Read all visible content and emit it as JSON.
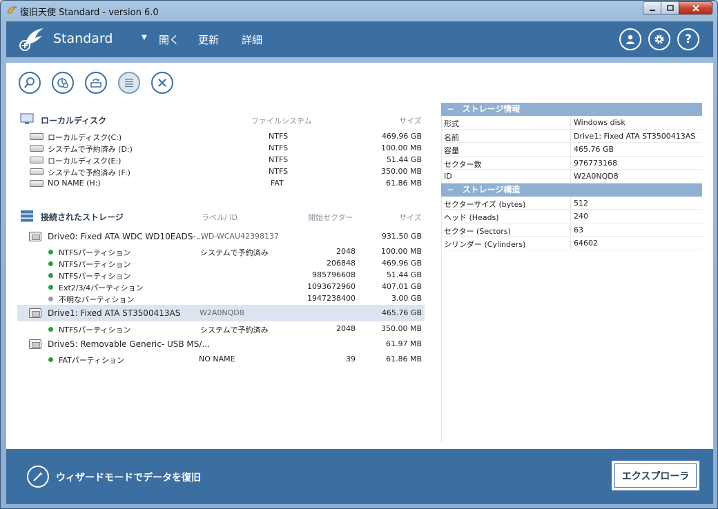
{
  "window": {
    "title": "復旧天使 Standard - version 6.0"
  },
  "header": {
    "brand": "Standard",
    "nav": [
      "開く",
      "更新",
      "詳細"
    ],
    "dropdown_glyph": "▼"
  },
  "local_disks": {
    "title": "ローカルディスク",
    "columns": {
      "fs": "ファイルシステム",
      "size": "サイズ"
    },
    "items": [
      {
        "name": "ローカルディスク(C:)",
        "fs": "NTFS",
        "size": "469.96 GB"
      },
      {
        "name": "システムで予約済み (D:)",
        "fs": "NTFS",
        "size": "100.00 MB"
      },
      {
        "name": "ローカルディスク(E:)",
        "fs": "NTFS",
        "size": "51.44 GB"
      },
      {
        "name": "システムで予約済み (F:)",
        "fs": "NTFS",
        "size": "350.00 MB"
      },
      {
        "name": "NO NAME (H:)",
        "fs": "FAT",
        "size": "61.86 MB"
      }
    ]
  },
  "storage": {
    "title": "接続されたストレージ",
    "columns": {
      "label": "ラベル/ ID",
      "start": "開始セクター",
      "size": "サイズ"
    },
    "drive0": {
      "name": "Drive0: Fixed ATA WDC WD10EADS-...",
      "label": "WD-WCAU42398137",
      "size": "931.50 GB"
    },
    "drive0_parts": [
      {
        "name": "NTFSパーティション",
        "label": "システムで予約済み",
        "start": "2048",
        "size": "100.00 MB"
      },
      {
        "name": "NTFSパーティション",
        "label": "",
        "start": "206848",
        "size": "469.96 GB"
      },
      {
        "name": "NTFSパーティション",
        "label": "",
        "start": "985796608",
        "size": "51.44 GB"
      },
      {
        "name": "Ext2/3/4パーティション",
        "label": "",
        "start": "1093672960",
        "size": "407.01 GB"
      },
      {
        "name": "不明なパーティション",
        "label": "",
        "start": "1947238400",
        "size": "3.00 GB"
      }
    ],
    "drive1": {
      "name": "Drive1: Fixed ATA ST3500413AS",
      "label": "W2A0NQD8",
      "size": "465.76 GB"
    },
    "drive1_parts": [
      {
        "name": "NTFSパーティション",
        "label": "システムで予約済み",
        "start": "2048",
        "size": "350.00 MB"
      }
    ],
    "drive5": {
      "name": "Drive5: Removable Generic- USB MS/...",
      "label": "",
      "size": "61.97 MB"
    },
    "drive5_parts": [
      {
        "name": "FATパーティション",
        "label": "NO NAME",
        "start": "39",
        "size": "61.86 MB"
      }
    ]
  },
  "info": {
    "storage_info_title": "ストレージ情報",
    "storage_info": [
      {
        "k": "形式",
        "v": "Windows disk"
      },
      {
        "k": "名前",
        "v": "Drive1: Fixed ATA ST3500413AS"
      },
      {
        "k": "容量",
        "v": "465.76 GB"
      },
      {
        "k": "セクター数",
        "v": "976773168"
      },
      {
        "k": "ID",
        "v": "W2A0NQD8"
      }
    ],
    "storage_struct_title": "ストレージ構造",
    "storage_struct": [
      {
        "k": "セクターサイズ (bytes)",
        "v": "512"
      },
      {
        "k": "ヘッド (Heads)",
        "v": "240"
      },
      {
        "k": "セクター (Sectors)",
        "v": "63"
      },
      {
        "k": "シリンダー (Cylinders)",
        "v": "64602"
      }
    ],
    "collapse_glyph": "−"
  },
  "footer": {
    "wizard_label": "ウィザードモードでデータを復旧",
    "explorer_label": "エクスプローラ"
  },
  "colors": {
    "accent": "#3c6fa1",
    "panel_header": "#8fb0d2",
    "selected_row": "#dbe5ef",
    "partition_ok": "#2e9c3c",
    "partition_unknown": "#999999"
  }
}
